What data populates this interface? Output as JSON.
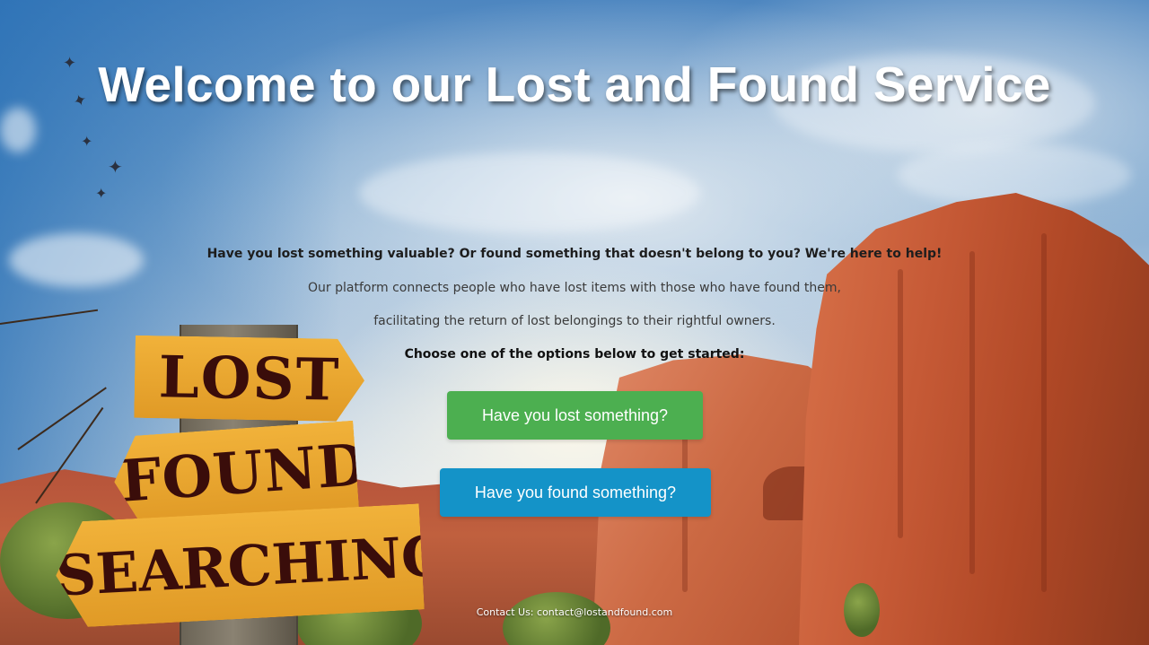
{
  "hero": {
    "title": "Welcome to our Lost and Found Service"
  },
  "intro": {
    "lead": "Have you lost something valuable? Or found something that doesn't belong to you? We're here to help!",
    "line_1": "Our platform connects people who have lost items with those who have found them,",
    "line_2": "facilitating the return of lost belongings to their rightful owners.",
    "prompt": "Choose one of the options below to get started:"
  },
  "actions": {
    "lost_label": "Have you lost something?",
    "found_label": "Have you found something?"
  },
  "signpost": {
    "sign_1": "LOST",
    "sign_2": "FOUND",
    "sign_3": "SEARCHING"
  },
  "footer": {
    "contact_prefix": "Contact Us:",
    "email": "contact@lostandfound.com"
  },
  "colors": {
    "lost_button": "#4caf50",
    "found_button": "#1493c8",
    "title_text": "#ffffff"
  }
}
